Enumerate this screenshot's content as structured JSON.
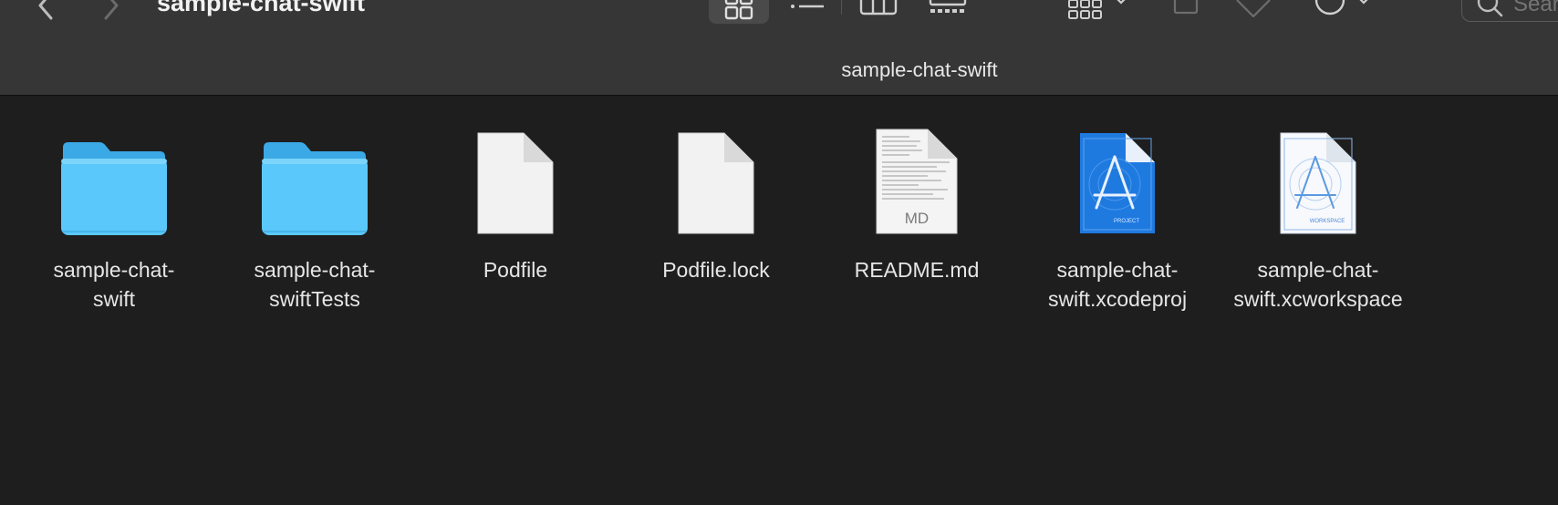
{
  "window": {
    "title": "sample-chat-swift",
    "location_title": "sample-chat-swift"
  },
  "toolbar": {
    "back_icon": "chevron-left-icon",
    "forward_icon": "chevron-right-icon",
    "views": [
      {
        "name": "icon-view",
        "icon": "grid-icon",
        "active": true
      },
      {
        "name": "list-view",
        "icon": "list-icon",
        "active": false
      },
      {
        "name": "column-view",
        "icon": "columns-icon",
        "active": false
      },
      {
        "name": "gallery-view",
        "icon": "gallery-icon",
        "active": false
      }
    ],
    "search_placeholder": "Search"
  },
  "files": [
    {
      "name_line1": "sample-chat-",
      "name_line2": "swift",
      "kind": "folder"
    },
    {
      "name_line1": "sample-chat-",
      "name_line2": "swiftTests",
      "kind": "folder"
    },
    {
      "name_line1": "Podfile",
      "name_line2": "",
      "kind": "document"
    },
    {
      "name_line1": "Podfile.lock",
      "name_line2": "",
      "kind": "document"
    },
    {
      "name_line1": "README.md",
      "name_line2": "",
      "kind": "markdown",
      "badge": "MD"
    },
    {
      "name_line1": "sample-chat-",
      "name_line2": "swift.xcodeproj",
      "kind": "xcodeproj",
      "badge": "PROJECT"
    },
    {
      "name_line1": "sample-chat-",
      "name_line2": "swift.xcworkspace",
      "kind": "xcworkspace",
      "badge": "WORKSPACE"
    }
  ],
  "colors": {
    "toolbar_bg": "#363636",
    "content_bg": "#1e1e1e",
    "folder_blue": "#5ac8fa",
    "xcode_blue": "#1f7ae0"
  }
}
